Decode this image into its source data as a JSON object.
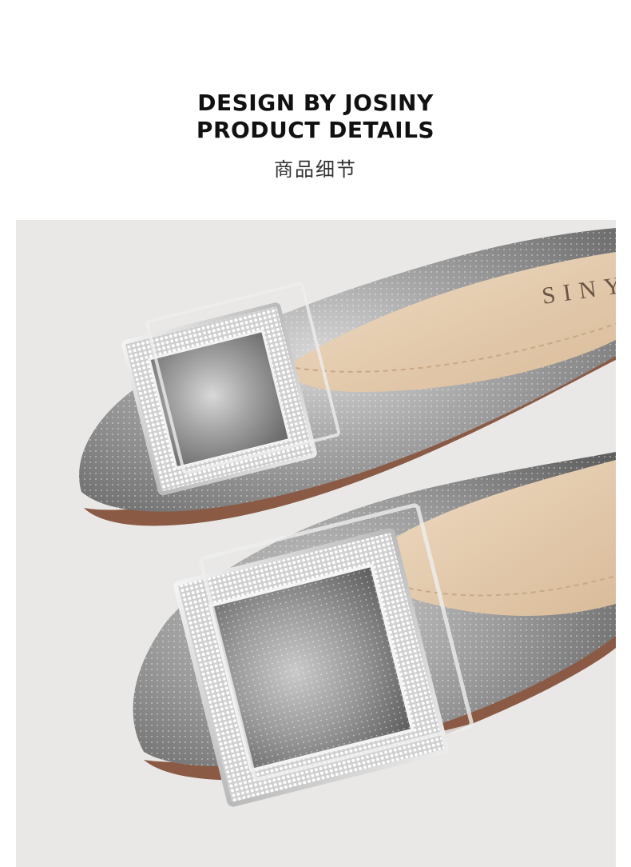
{
  "header": {
    "title_line_1": "DESIGN BY JOSINY",
    "title_line_2": "PRODUCT DETAILS",
    "subtitle": "商品细节"
  },
  "photo": {
    "insole_logo_text": "SINY",
    "shoe_color": "silver glitter",
    "buckle_icon": "rhinestone-square-buckle-icon"
  },
  "colors": {
    "background": "#ffffff",
    "photo_backdrop": "#e9e8e6",
    "shoe_silver": "#9a9a9a",
    "lining_beige": "#e7cfb3",
    "sole_brown": "#8a5a45",
    "title_text": "#111111"
  }
}
